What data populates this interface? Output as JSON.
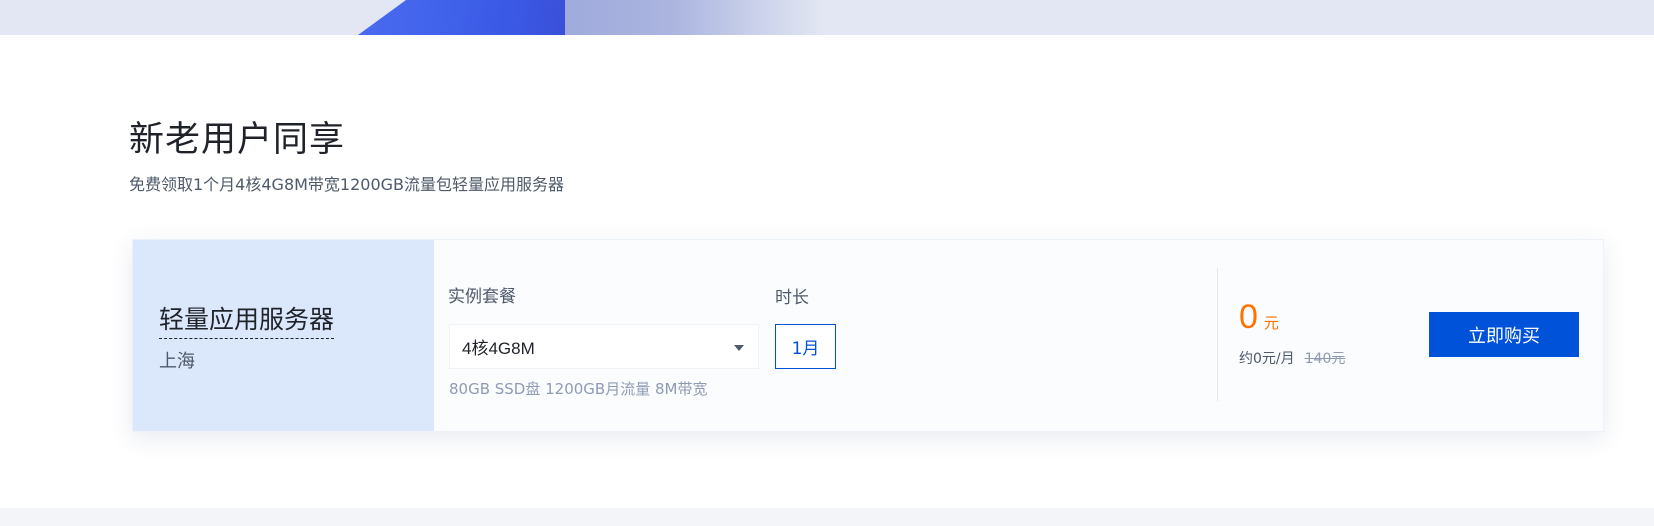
{
  "section": {
    "title": "新老用户同享",
    "subtitle": "免费领取1个月4核4G8M带宽1200GB流量包轻量应用服务器"
  },
  "card": {
    "product_name": "轻量应用服务器",
    "region": "上海",
    "plan_label": "实例套餐",
    "plan_selected": "4核4G8M",
    "plan_spec": "80GB SSD盘 1200GB月流量 8M带宽",
    "duration_label": "时长",
    "duration_selected": "1月",
    "price_value": "0",
    "price_unit": "元",
    "monthly_price": "约0元/月",
    "original_price": "140元",
    "buy_label": "立即购买"
  },
  "colors": {
    "accent": "#0052d9",
    "price": "#ff7200",
    "card_left_bg": "#dbe7fb"
  },
  "icons": {
    "dropdown": "chevron-down-icon"
  }
}
